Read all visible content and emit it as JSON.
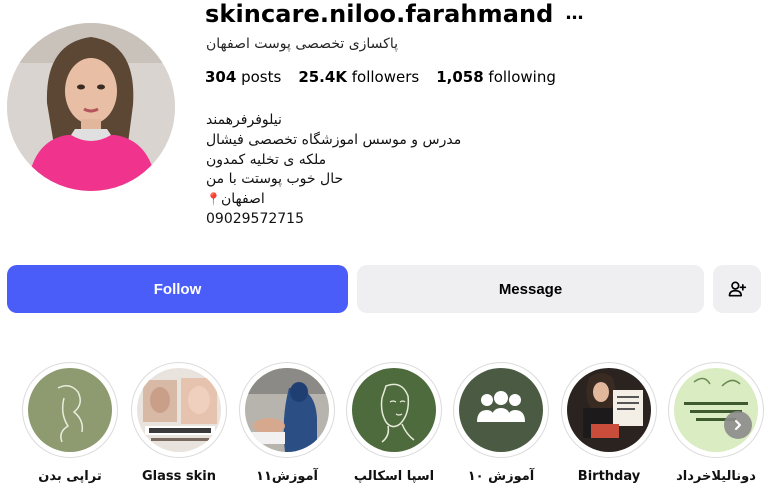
{
  "profile": {
    "username": "skincare.niloo.farahmand",
    "more_icon": "…",
    "subtitle": "پاکسازی تخصصی پوست اصفهان",
    "stats": [
      {
        "count": "304",
        "label": "posts"
      },
      {
        "count": "25.4K",
        "label": "followers"
      },
      {
        "count": "1,058",
        "label": "following"
      }
    ],
    "bio": {
      "line1": "نیلوفرفرهمند",
      "line2": "مدرس و موسس اموزشگاه تخصصی فیشال",
      "line3": "ملکه ی تخلیه کمدون",
      "line4": "حال خوب پوستت با من",
      "line5": "اصفهان",
      "line5_icon": "round-pushpin-icon",
      "phone": "09029572715"
    }
  },
  "actions": {
    "follow_label": "Follow",
    "message_label": "Message",
    "add_user_icon": "person-add-icon"
  },
  "highlights": [
    {
      "label": "تراپی بدن",
      "icon": "body-line-art-icon",
      "bg": "#8e9a70"
    },
    {
      "label": "Glass skin",
      "icon": "glass-skin-photo",
      "bg": "#e9e3de"
    },
    {
      "label": "آموزش۱۱",
      "icon": "training-photo",
      "bg": "#2b4f84"
    },
    {
      "label": "اسپا اسکالپ",
      "icon": "face-line-art-icon",
      "bg": "#4e6b3d"
    },
    {
      "label": "آموزش ۱۰",
      "icon": "group-icon",
      "bg": "#4b5a43"
    },
    {
      "label": "Birthday",
      "icon": "birthday-photo",
      "bg": "#2a2320"
    },
    {
      "label": "دونالیلاخرداد",
      "icon": "workshop-poster-photo",
      "bg": "#d9ecc2"
    }
  ],
  "colors": {
    "follow_button": "#4a5df9",
    "secondary_button": "#efeff2"
  }
}
